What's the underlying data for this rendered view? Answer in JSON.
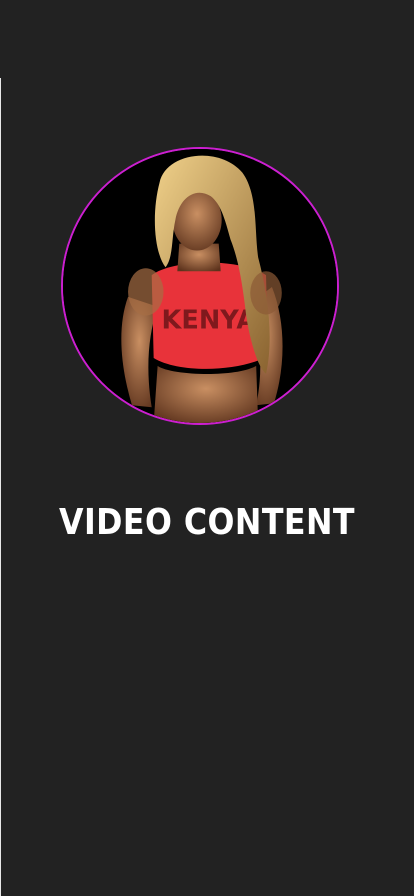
{
  "page": {
    "background": "#222222",
    "accent": "#cc1fd1"
  },
  "avatar": {
    "subject": "fitness-model-photo",
    "shirt_color": "#e8333a",
    "hair_color": "#d9b06a",
    "shirt_text": "KENYA"
  },
  "section": {
    "title": "VIDEO CONTENT"
  }
}
